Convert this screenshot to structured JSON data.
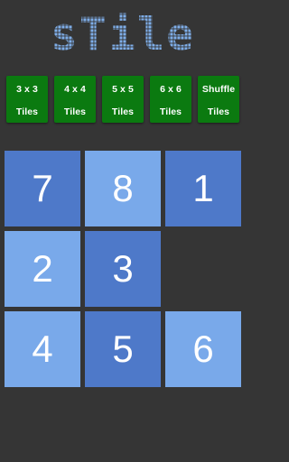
{
  "app": {
    "title": "sTile",
    "title_color": "#7faee9",
    "background": "#353535"
  },
  "modes": [
    {
      "line1": "3 x 3",
      "line2": "Tiles"
    },
    {
      "line1": "4 x 4",
      "line2": "Tiles"
    },
    {
      "line1": "5 x 5",
      "line2": "Tiles"
    },
    {
      "line1": "6 x 6",
      "line2": "Tiles"
    },
    {
      "line1": "Shuffle",
      "line2": "Tiles"
    }
  ],
  "mode_button_color": "#0b7a10",
  "board": {
    "size": 3,
    "tiles": [
      "7",
      "8",
      "1",
      "2",
      "3",
      "",
      "4",
      "5",
      "6"
    ],
    "shades": [
      "dark",
      "light",
      "dark",
      "light",
      "dark",
      "empty",
      "light",
      "dark",
      "light"
    ],
    "colors": {
      "dark": "#4e79c9",
      "light": "#79a9ea"
    }
  }
}
